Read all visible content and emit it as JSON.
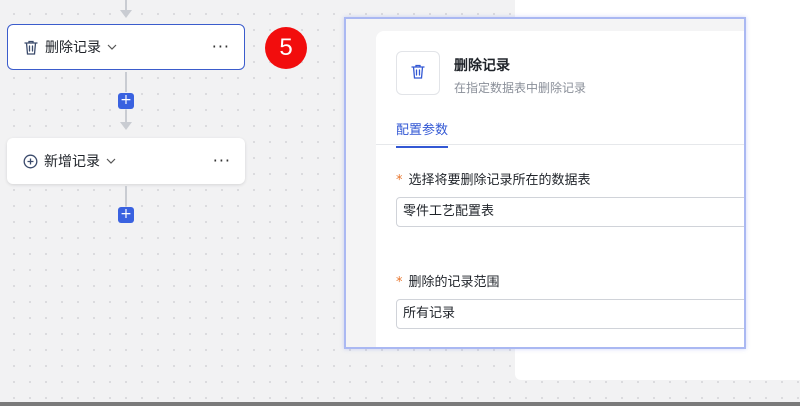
{
  "flow": {
    "nodes": [
      {
        "label": "删除记录",
        "icon": "trash-icon",
        "more": "···"
      },
      {
        "label": "新增记录",
        "icon": "plus-circle-icon",
        "more": "···"
      }
    ],
    "add_button": "+",
    "step_badge": "5"
  },
  "config": {
    "action_title": "删除记录",
    "action_desc": "在指定数据表中删除记录",
    "tab": "配置参数",
    "fields": [
      {
        "required": "*",
        "label": "选择将要删除记录所在的数据表",
        "value": "零件工艺配置表"
      },
      {
        "required": "*",
        "label": "删除的记录范围",
        "value": "所有记录"
      }
    ]
  },
  "colors": {
    "accent": "#3358d4",
    "badge": "#f20d0d",
    "required": "#e8742a",
    "add_button": "#3a62e0"
  }
}
